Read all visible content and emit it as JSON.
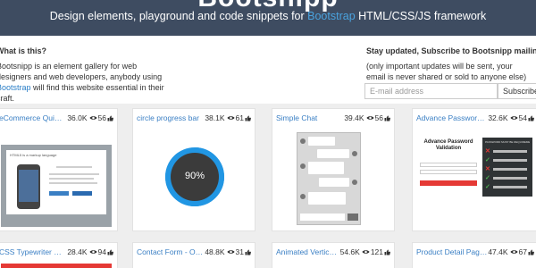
{
  "hero": {
    "logo": "Bootsnipp",
    "tagline_before": "Design elements, playground and code snippets for ",
    "tagline_link": "Bootstrap",
    "tagline_after": " HTML/CSS/JS framework"
  },
  "info": {
    "title": "What is this?",
    "desc_before": "Bootsnipp is an element gallery for web designers and web developers, anybody using ",
    "desc_link": "Bootstrap",
    "desc_after": " will find this website essential in their craft."
  },
  "subscribe": {
    "title": "Stay updated, Subscribe to Bootsnipp mailing list",
    "desc": "(only important updates will be sent, your email is never shared or sold to anyone else)",
    "placeholder": "E-mail address",
    "value": "",
    "button_label": "Subscribe"
  },
  "cards": [
    {
      "title": "eCommerce Quick view",
      "views": "36.0K",
      "likes": "56"
    },
    {
      "title": "circle progress bar",
      "views": "38.1K",
      "likes": "61"
    },
    {
      "title": "Simple Chat",
      "views": "39.4K",
      "likes": "56"
    },
    {
      "title": "Advance Password Validation",
      "views": "32.6K",
      "likes": "54"
    },
    {
      "title": "CSS Typewriter (Text Animation)",
      "views": "28.4K",
      "likes": "94"
    },
    {
      "title": "Contact Form - One page",
      "views": "48.8K",
      "likes": "31"
    },
    {
      "title": "Animated Vertical Bootstrap Tabs",
      "views": "54.6K",
      "likes": "121"
    },
    {
      "title": "Product Detail Page - E-commerce",
      "views": "47.4K",
      "likes": "67"
    }
  ],
  "thumbs": {
    "quick_view_modal_title": "HTML5 is a markup language",
    "progress_value": 0.9,
    "progress_label": "90%",
    "password_title": "Advance Password Validation",
    "password_panel_title": "PASSWORD MUST BE REQUIREMENTS"
  },
  "colors": {
    "hero_bg": "#3e4c61",
    "link": "#3a7fc4",
    "progress": "#2196e3",
    "accent_red": "#e53935"
  }
}
